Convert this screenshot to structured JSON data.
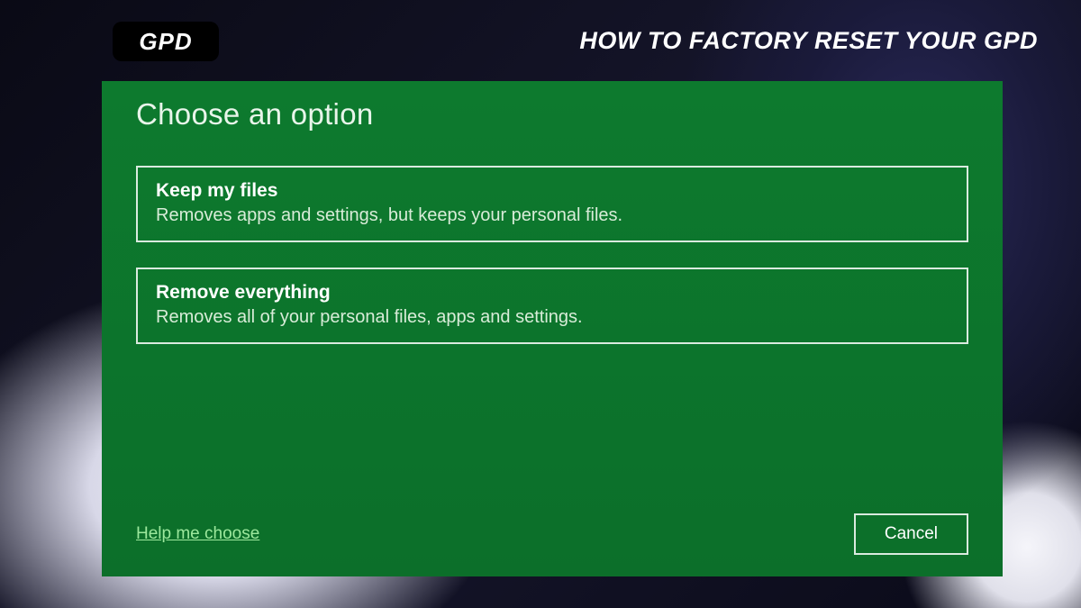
{
  "logo": {
    "text": "GPD"
  },
  "header": {
    "title": "HOW TO FACTORY RESET YOUR GPD"
  },
  "panel": {
    "title": "Choose an option",
    "options": [
      {
        "title": "Keep my files",
        "description": "Removes apps and settings, but keeps your personal files."
      },
      {
        "title": "Remove everything",
        "description": "Removes all of your personal files, apps and settings."
      }
    ],
    "help_link": "Help me choose",
    "cancel_label": "Cancel"
  },
  "colors": {
    "panel_bg": "#0d7a2e",
    "text_light": "#e8f5ea",
    "link": "#9de89d"
  }
}
